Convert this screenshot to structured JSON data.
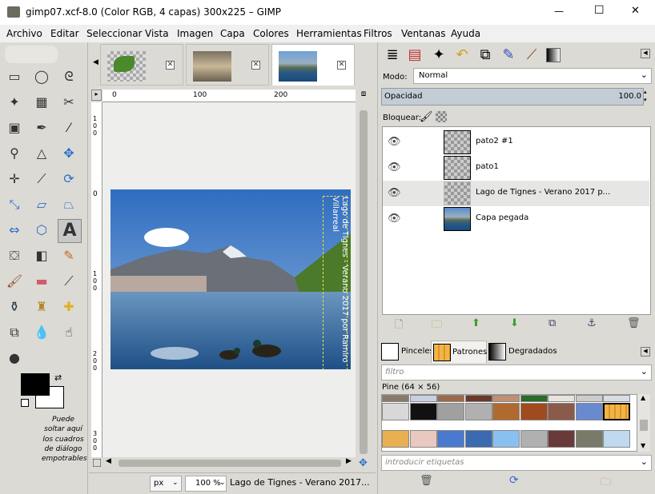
{
  "window": {
    "title": "gimp07.xcf-8.0 (Color RGB, 4 capas) 300x225 – GIMP",
    "minimize": "—",
    "maximize": "☐",
    "close": "✕"
  },
  "menu": [
    {
      "label": "Archivo"
    },
    {
      "label": "Editar"
    },
    {
      "label": "Seleccionar"
    },
    {
      "label": "Vista"
    },
    {
      "label": "Imagen"
    },
    {
      "label": "Capa"
    },
    {
      "label": "Colores"
    },
    {
      "label": "Herramientas"
    },
    {
      "label": "Filtros"
    },
    {
      "label": "Ventanas"
    },
    {
      "label": "Ayuda"
    }
  ],
  "toolbox": {
    "drop_hint": "Puede soltar aquí los cuadros de diálogo empotrables"
  },
  "ruler": {
    "h_ticks": [
      "0",
      "100",
      "200"
    ],
    "v_ticks": [
      "0",
      "1 0 0",
      "2 0 0",
      "3 0 0"
    ],
    "v_top": "1 0 0"
  },
  "image_text": "Lago de Tignes - Verano 2017 por Ramiro Villarreal",
  "statusbar": {
    "unit": "px",
    "zoom": "100 %",
    "message": "Lago de Tignes - Verano 2017..."
  },
  "layers": {
    "mode_label": "Modo:",
    "mode_value": "Normal",
    "opacity_label": "Opacidad",
    "opacity_value": "100.0",
    "lock_label": "Bloquear:",
    "items": [
      {
        "name": "pato2 #1"
      },
      {
        "name": "pato1"
      },
      {
        "name": "Lago de Tignes - Verano 2017 p..."
      },
      {
        "name": "Capa pegada"
      }
    ]
  },
  "brushes": {
    "tabs": [
      "Pinceles",
      "Patrones",
      "Degradados"
    ],
    "filter_placeholder": "filtro",
    "pattern_name": "Pine (64 × 56)",
    "tags_placeholder": "introducir etiquetas"
  },
  "colors": {
    "accent": "#c3cdd6",
    "selected_pattern": "#f2b447"
  }
}
